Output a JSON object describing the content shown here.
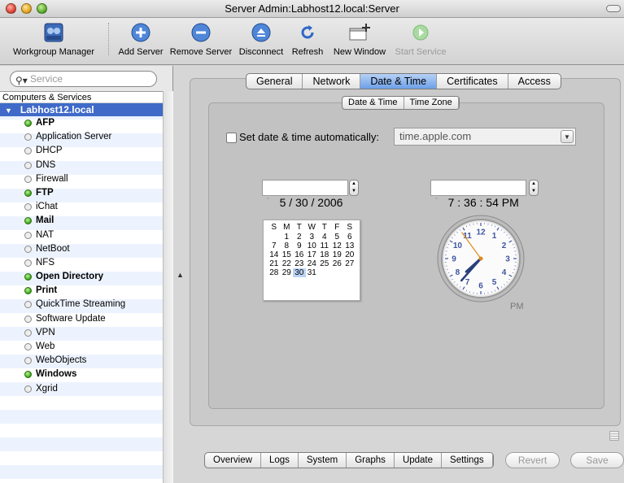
{
  "window": {
    "title": "Server Admin:Labhost12.local:Server"
  },
  "toolbar": {
    "workgroup_manager": "Workgroup Manager",
    "add_server": "Add Server",
    "remove_server": "Remove Server",
    "disconnect": "Disconnect",
    "refresh": "Refresh",
    "new_window": "New Window",
    "start_service": "Start Service"
  },
  "sidebar": {
    "search_placeholder": "Service",
    "header": "Computers & Services",
    "host": "Labhost12.local",
    "services": [
      {
        "label": "AFP",
        "running": true
      },
      {
        "label": "Application Server",
        "running": false
      },
      {
        "label": "DHCP",
        "running": false
      },
      {
        "label": "DNS",
        "running": false
      },
      {
        "label": "Firewall",
        "running": false
      },
      {
        "label": "FTP",
        "running": true
      },
      {
        "label": "iChat",
        "running": false
      },
      {
        "label": "Mail",
        "running": true
      },
      {
        "label": "NAT",
        "running": false
      },
      {
        "label": "NetBoot",
        "running": false
      },
      {
        "label": "NFS",
        "running": false
      },
      {
        "label": "Open Directory",
        "running": true
      },
      {
        "label": "Print",
        "running": true
      },
      {
        "label": "QuickTime Streaming",
        "running": false
      },
      {
        "label": "Software Update",
        "running": false
      },
      {
        "label": "VPN",
        "running": false
      },
      {
        "label": "Web",
        "running": false
      },
      {
        "label": "WebObjects",
        "running": false
      },
      {
        "label": "Windows",
        "running": true
      },
      {
        "label": "Xgrid",
        "running": false
      }
    ]
  },
  "tabs": {
    "items": [
      "General",
      "Network",
      "Date & Time",
      "Certificates",
      "Access"
    ],
    "selected": "Date & Time"
  },
  "subtabs": {
    "items": [
      "Date & Time",
      "Time Zone"
    ],
    "selected": "Date & Time"
  },
  "datetime": {
    "auto_label": "Set date & time automatically:",
    "auto_checked": false,
    "server": "time.apple.com",
    "date_month": "5",
    "date_day": "30",
    "date_year": "2006",
    "time_hour": "7",
    "time_minute": "36",
    "time_second": "54",
    "time_ampm": "PM",
    "clock_ampm": "PM",
    "date_sep": "/",
    "time_sep": ":"
  },
  "calendar": {
    "weekdays": [
      "S",
      "M",
      "T",
      "W",
      "T",
      "F",
      "S"
    ],
    "weeks": [
      [
        "",
        "1",
        "2",
        "3",
        "4",
        "5",
        "6"
      ],
      [
        "7",
        "8",
        "9",
        "10",
        "11",
        "12",
        "13"
      ],
      [
        "14",
        "15",
        "16",
        "17",
        "18",
        "19",
        "20"
      ],
      [
        "21",
        "22",
        "23",
        "24",
        "25",
        "26",
        "27"
      ],
      [
        "28",
        "29",
        "30",
        "31",
        "",
        "",
        ""
      ]
    ],
    "selected_day": "30"
  },
  "clock_face": {
    "numerals": [
      "12",
      "1",
      "2",
      "3",
      "4",
      "5",
      "6",
      "7",
      "8",
      "9",
      "10",
      "11"
    ],
    "hour": 7,
    "minute": 36,
    "second": 54
  },
  "bottom_tabs": {
    "items": [
      "Overview",
      "Logs",
      "System",
      "Graphs",
      "Update",
      "Settings"
    ],
    "selected": "Settings"
  },
  "buttons": {
    "revert": "Revert",
    "save": "Save"
  },
  "colors": {
    "selection": "#3f6ac8",
    "running": "#3faa1b",
    "tab_selected": "#6da0e8"
  }
}
